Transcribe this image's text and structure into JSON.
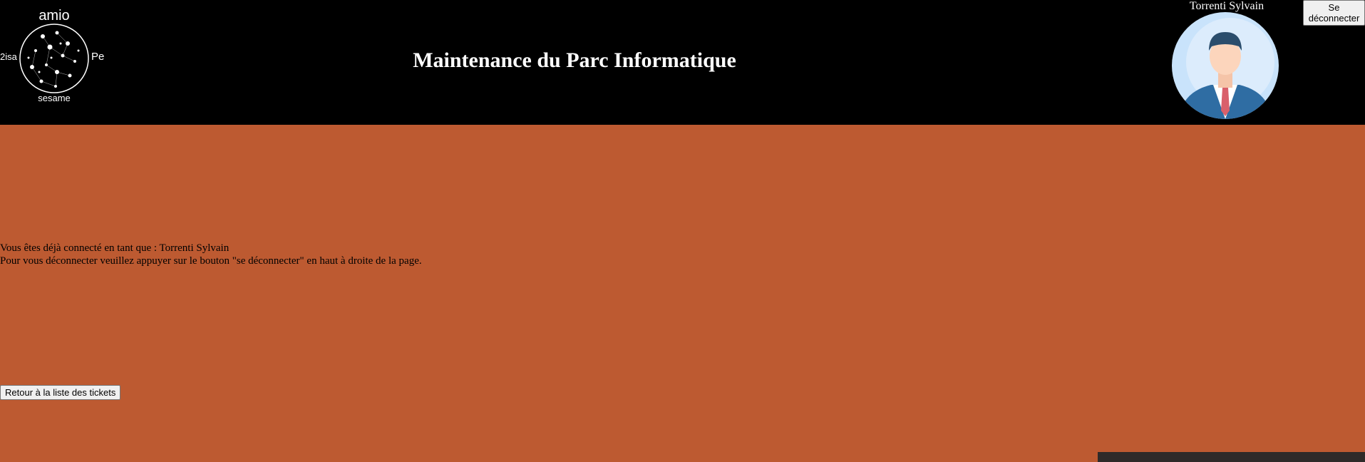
{
  "header": {
    "logo": {
      "top_text": "amio",
      "bottom_text": "sesame",
      "left_text": "2isa",
      "right_text": "Pe"
    },
    "title": "Maintenance du Parc Informatique",
    "user_name": "Torrenti Sylvain",
    "logout_label": "Se déconnecter"
  },
  "main": {
    "message_line1": "Vous êtes déjà connecté en tant que : Torrenti Sylvain",
    "message_line2": "Pour vous déconnecter veuillez appuyer sur le bouton \"se déconnecter\" en haut à droite de la page.",
    "back_button_label": "Retour à la liste des tickets"
  },
  "colors": {
    "header_bg": "#000000",
    "page_bg": "#bd5a31",
    "header_text": "#ffffff"
  }
}
